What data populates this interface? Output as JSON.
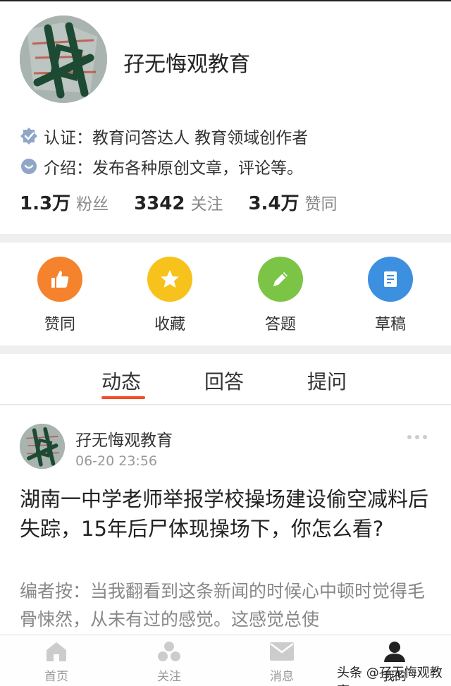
{
  "profile": {
    "name": "孖无悔观教育",
    "verify_label": "认证：",
    "verify_text": "教育问答达人 教育领域创作者",
    "intro_label": "介绍：",
    "intro_text": "发布各种原创文章，评论等。",
    "stats": [
      {
        "num": "1.3万",
        "label": "粉丝"
      },
      {
        "num": "3342",
        "label": "关注"
      },
      {
        "num": "3.4万",
        "label": "赞同"
      }
    ]
  },
  "actions": [
    {
      "label": "赞同",
      "color": "#f5822c",
      "icon": "thumbs-up-icon"
    },
    {
      "label": "收藏",
      "color": "#f7c21c",
      "icon": "star-icon"
    },
    {
      "label": "答题",
      "color": "#7cc445",
      "icon": "pencil-icon"
    },
    {
      "label": "草稿",
      "color": "#3d8fe0",
      "icon": "document-icon"
    }
  ],
  "tabs": [
    {
      "label": "动态",
      "active": true
    },
    {
      "label": "回答",
      "active": false
    },
    {
      "label": "提问",
      "active": false
    }
  ],
  "post": {
    "author": "孖无悔观教育",
    "time": "06-20 23:56",
    "title": "湖南一中学老师举报学校操场建设偷空减料后失踪，15年后尸体现操场下，你怎么看?",
    "excerpt": "编者按：当我翻看到这条新闻的时候心中顿时觉得毛骨悚然，从未有过的感觉。这感觉总使"
  },
  "nav": [
    {
      "label": "首页",
      "icon": "home-icon"
    },
    {
      "label": "关注",
      "icon": "follow-icon"
    },
    {
      "label": "消息",
      "icon": "mail-icon"
    },
    {
      "label": "我的",
      "icon": "user-icon"
    }
  ],
  "watermark": "头条 @孖无悔观教育",
  "colors": {
    "accent": "#f04e2a",
    "verify_icon": "#8fa6c6"
  }
}
